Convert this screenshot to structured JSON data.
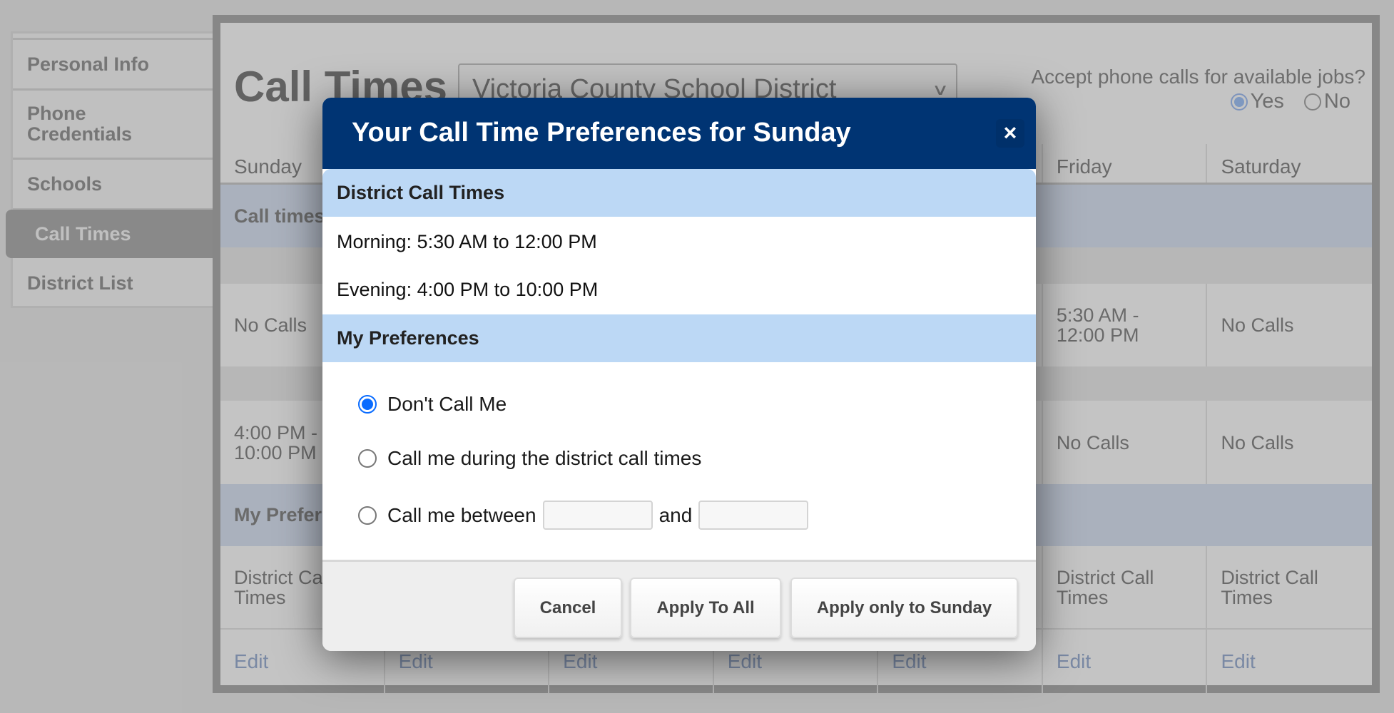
{
  "sidebar": {
    "items": [
      {
        "label": "Personal Info",
        "active": false
      },
      {
        "label": "Phone Credentials",
        "active": false
      },
      {
        "label": "Schools",
        "active": false
      },
      {
        "label": "Call Times",
        "active": true
      },
      {
        "label": "District List",
        "active": false
      }
    ]
  },
  "main": {
    "title": "Call Times",
    "district_select": {
      "value": "Victoria County School District"
    },
    "accept_calls": {
      "question": "Accept phone calls for available jobs?",
      "options": [
        {
          "label": "Yes",
          "checked": true
        },
        {
          "label": "No",
          "checked": false
        }
      ]
    },
    "table": {
      "headers": [
        "Sunday",
        "",
        "",
        "",
        "",
        "Friday",
        "Saturday"
      ],
      "call_times_band": "Call times",
      "morning_row": [
        "No Calls",
        "",
        "",
        "",
        "",
        "5:30 AM - 12:00 PM",
        "No Calls"
      ],
      "evening_row": [
        "4:00 PM - 10:00 PM",
        "",
        "",
        "",
        "",
        "No Calls",
        "No Calls"
      ],
      "preferences_band": "My Preferences",
      "preferences_row": [
        "District Call Times",
        "",
        "",
        "",
        "",
        "District Call Times",
        "District Call Times"
      ],
      "edit_row": [
        "Edit",
        "Edit",
        "Edit",
        "Edit",
        "Edit",
        "Edit",
        "Edit"
      ]
    }
  },
  "dialog": {
    "title": "Your Call Time Preferences for Sunday",
    "close_label": "×",
    "district_section": {
      "heading": "District Call Times",
      "morning": "Morning: 5:30 AM to 12:00 PM",
      "evening": "Evening: 4:00 PM to 10:00 PM"
    },
    "preferences_section": {
      "heading": "My Preferences",
      "options": [
        {
          "label": "Don't Call Me",
          "checked": true
        },
        {
          "label": "Call me during the district call times",
          "checked": false
        },
        {
          "label": "Call me between",
          "checked": false
        }
      ],
      "between_conjunction": "and",
      "start_time_value": "",
      "end_time_value": ""
    },
    "buttons": {
      "cancel": "Cancel",
      "apply_all": "Apply To All",
      "apply_day": "Apply only to Sunday"
    }
  },
  "colors": {
    "dialog_header": "#003473",
    "section_band": "#bcd8f5",
    "radio_accent": "#0a6cff",
    "table_band": "#dde7f6",
    "edit_link": "#9fb3d6"
  }
}
